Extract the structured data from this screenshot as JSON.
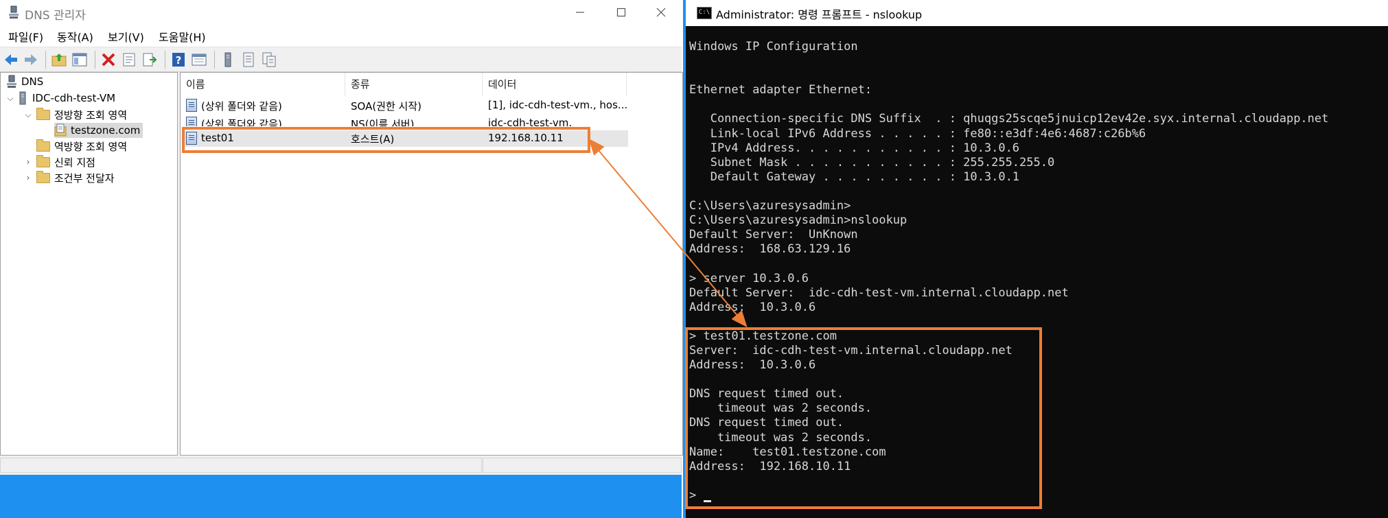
{
  "dns_window": {
    "title": "DNS 관리자",
    "menus": [
      "파일(F)",
      "동작(A)",
      "보기(V)",
      "도움말(H)"
    ],
    "toolbar_icons": [
      "back-arrow-icon",
      "forward-arrow-icon",
      "folder-up-icon",
      "console-tree-icon",
      "delete-icon",
      "properties-icon",
      "export-icon",
      "help-icon",
      "console-view-icon",
      "server-icon",
      "zone-list-icon",
      "record-list-icon"
    ],
    "tree": {
      "root": "DNS",
      "server": "IDC-cdh-test-VM",
      "forward_zones": "정방향 조회 영역",
      "selected_zone": "testzone.com",
      "reverse_zones": "역방향 조회 영역",
      "trust_points": "신뢰 지점",
      "conditional_forwarders": "조건부 전달자"
    },
    "columns": [
      "이름",
      "종류",
      "데이터"
    ],
    "records": [
      {
        "name": "(상위 폴더와 같음)",
        "type": "SOA(권한 시작)",
        "data": "[1], idc-cdh-test-vm., hos..."
      },
      {
        "name": "(상위 폴더와 같음)",
        "type": "NS(이름 서버)",
        "data": "idc-cdh-test-vm."
      },
      {
        "name": "test01",
        "type": "호스트(A)",
        "data": "192.168.10.11"
      }
    ]
  },
  "cmd_window": {
    "title": "Administrator: 명령 프롬프트 - nslookup",
    "icon_text": "C:\\",
    "lines": [
      "Windows IP Configuration",
      "",
      "",
      "Ethernet adapter Ethernet:",
      "",
      "   Connection-specific DNS Suffix  . : qhuqgs25scqe5jnuicp12ev42e.syx.internal.cloudapp.net",
      "   Link-local IPv6 Address . . . . . : fe80::e3df:4e6:4687:c26b%6",
      "   IPv4 Address. . . . . . . . . . . : 10.3.0.6",
      "   Subnet Mask . . . . . . . . . . . : 255.255.255.0",
      "   Default Gateway . . . . . . . . . : 10.3.0.1",
      "",
      "C:\\Users\\azuresysadmin>",
      "C:\\Users\\azuresysadmin>nslookup",
      "Default Server:  UnKnown",
      "Address:  168.63.129.16",
      "",
      "> server 10.3.0.6",
      "Default Server:  idc-cdh-test-vm.internal.cloudapp.net",
      "Address:  10.3.0.6",
      "",
      "> test01.testzone.com",
      "Server:  idc-cdh-test-vm.internal.cloudapp.net",
      "Address:  10.3.0.6",
      "",
      "DNS request timed out.",
      "    timeout was 2 seconds.",
      "DNS request timed out.",
      "    timeout was 2 seconds.",
      "Name:    test01.testzone.com",
      "Address:  192.168.10.11",
      "",
      ">"
    ]
  },
  "colors": {
    "highlight": "#ee7e34",
    "taskbar": "#1e90f0",
    "console_bg": "#0c0c0c",
    "console_text": "#d8d8d8"
  }
}
